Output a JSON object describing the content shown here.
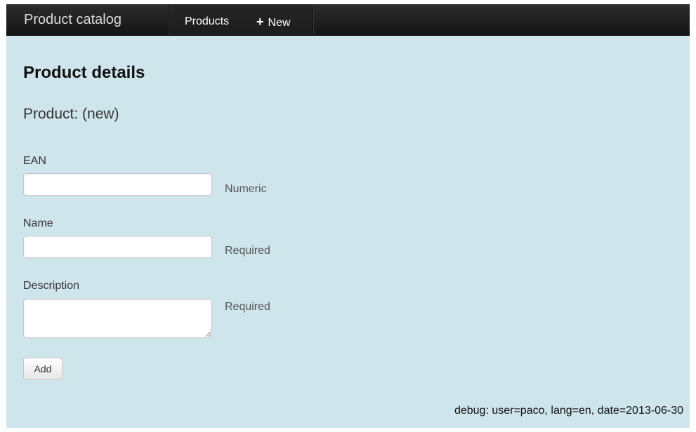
{
  "navbar": {
    "brand": "Product catalog",
    "links": {
      "products": "Products",
      "new": "New"
    }
  },
  "page": {
    "title": "Product details",
    "subtitle": "Product: (new)"
  },
  "form": {
    "ean": {
      "label": "EAN",
      "value": "",
      "help": "Numeric"
    },
    "name": {
      "label": "Name",
      "value": "",
      "help": "Required"
    },
    "description": {
      "label": "Description",
      "value": "",
      "help": "Required"
    },
    "submit_label": "Add"
  },
  "footer": {
    "debug": "debug: user=paco, lang=en, date=2013-06-30"
  },
  "icons": {
    "new_link_icon": "plus-icon"
  },
  "colors": {
    "page_background": "#cfe5ec",
    "navbar_background": "#1c1c1c"
  }
}
